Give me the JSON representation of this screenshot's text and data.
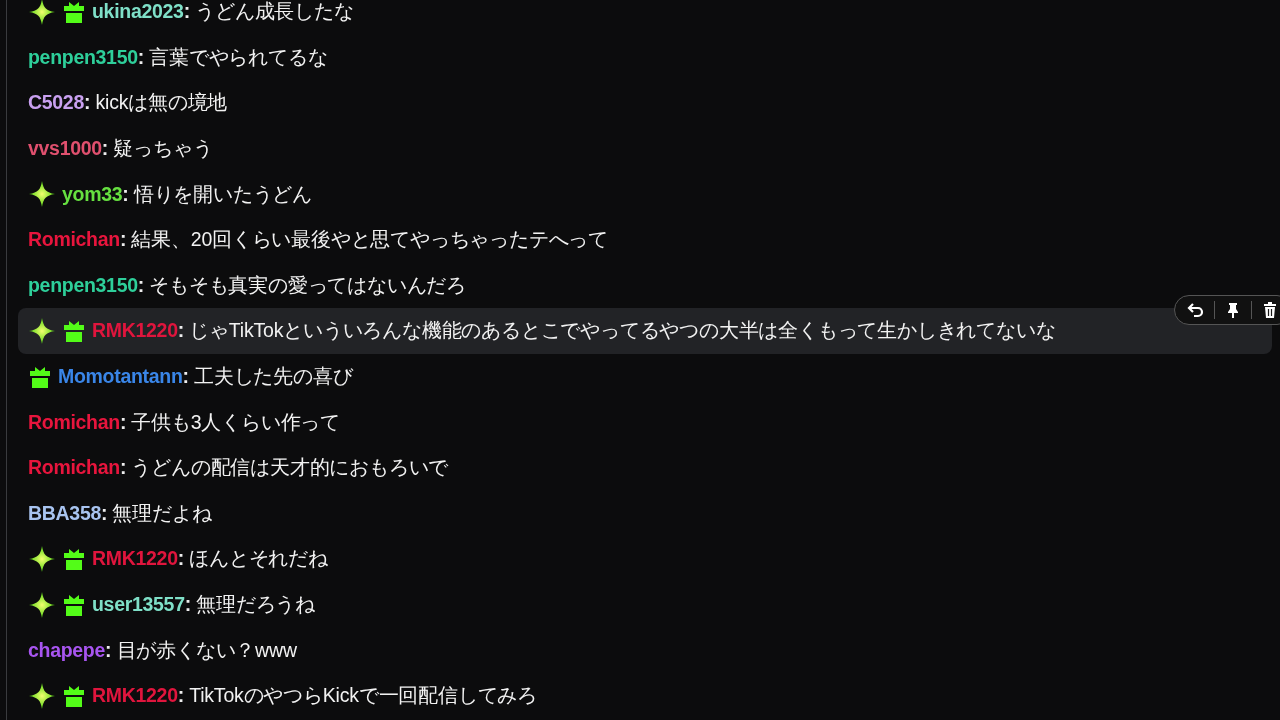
{
  "messages": [
    {
      "badges": [
        {
          "kind": "sparkle"
        },
        {
          "kind": "gift"
        }
      ],
      "username": "ukina2023",
      "color": "#7fe0c8",
      "separator": ":",
      "text": "うどん成長したな",
      "hovered": false
    },
    {
      "username": "penpen3150",
      "color": "#2ecf9a",
      "separator": ":",
      "text": "言葉でやられてるな",
      "hovered": false
    },
    {
      "username": "C5028",
      "color": "#c9a0f0",
      "separator": ":",
      "text": "kickは無の境地",
      "hovered": false
    },
    {
      "username": "vvs1000",
      "color": "#e0506e",
      "separator": ":",
      "text": "疑っちゃう",
      "hovered": false
    },
    {
      "badges": [
        {
          "kind": "sparkle"
        }
      ],
      "username": "yom33",
      "color": "#66e040",
      "separator": ":",
      "text": "悟りを開いたうどん",
      "hovered": false
    },
    {
      "username": "Romichan",
      "color": "#e8153d",
      "separator": ":",
      "text": "結果、20回くらい最後やと思てやっちゃったテへって",
      "hovered": false
    },
    {
      "username": "penpen3150",
      "color": "#2ecf9a",
      "separator": ":",
      "text": "そもそも真実の愛ってはないんだろ",
      "hovered": false
    },
    {
      "badges": [
        {
          "kind": "sparkle"
        },
        {
          "kind": "gift"
        }
      ],
      "username": "RMK1220",
      "color": "#e0153d",
      "separator": ":",
      "text": "じゃTikTokといういろんな機能のあるとこでやってるやつの大半は全くもって生かしきれてないな",
      "hovered": true
    },
    {
      "badges": [
        {
          "kind": "gift"
        }
      ],
      "username": "Momotantann",
      "color": "#3a86e8",
      "separator": ":",
      "text": "工夫した先の喜び",
      "hovered": false
    },
    {
      "username": "Romichan",
      "color": "#e8153d",
      "separator": ":",
      "text": "子供も3人くらい作って",
      "hovered": false
    },
    {
      "username": "Romichan",
      "color": "#e8153d",
      "separator": ":",
      "text": "うどんの配信は天才的におもろいで",
      "hovered": false
    },
    {
      "username": "BBA358",
      "color": "#a8c4f0",
      "separator": ":",
      "text": "無理だよね",
      "hovered": false
    },
    {
      "badges": [
        {
          "kind": "sparkle"
        },
        {
          "kind": "gift"
        }
      ],
      "username": "RMK1220",
      "color": "#e0153d",
      "separator": ":",
      "text": "ほんとそれだね",
      "hovered": false
    },
    {
      "badges": [
        {
          "kind": "sparkle"
        },
        {
          "kind": "gift"
        }
      ],
      "username": "user13557",
      "color": "#7fe0c8",
      "separator": ":",
      "text": "無理だろうね",
      "hovered": false
    },
    {
      "username": "chapepe",
      "color": "#a855f0",
      "separator": ":",
      "text": "目が赤くない？www",
      "hovered": false
    },
    {
      "badges": [
        {
          "kind": "sparkle"
        },
        {
          "kind": "gift"
        }
      ],
      "username": "RMK1220",
      "color": "#e0153d",
      "separator": ":",
      "text": "TikTokのやつらKickで一回配信してみろ",
      "hovered": false
    }
  ]
}
